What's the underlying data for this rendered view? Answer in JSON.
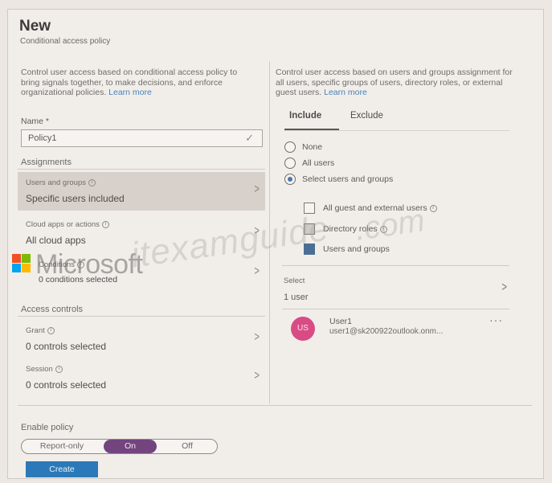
{
  "header": {
    "title": "New",
    "subtitle": "Conditional access policy"
  },
  "left": {
    "description": "Control user access based on conditional access policy to bring signals together, to make decisions, and enforce organizational policies.",
    "learn_more": "Learn more",
    "name_label": "Name *",
    "name_value": "Policy1",
    "assignments_heading": "Assignments",
    "users_label": "Users and groups",
    "users_value": "Specific users included",
    "cloud_label": "Cloud apps or actions",
    "cloud_value": "All cloud apps",
    "conditions_label": "Conditions",
    "conditions_value": "0 conditions selected",
    "access_heading": "Access controls",
    "grant_label": "Grant",
    "grant_value": "0 controls selected",
    "session_label": "Session",
    "session_value": "0 controls selected",
    "enable_label": "Enable policy",
    "toggle_options": [
      "Report-only",
      "On",
      "Off"
    ],
    "toggle_selected": "On",
    "create_label": "Create"
  },
  "right": {
    "description": "Control user access based on users and groups assignment for all users, specific groups of users, directory roles, or external guest users.",
    "learn_more": "Learn more",
    "tabs": [
      "Include",
      "Exclude"
    ],
    "active_tab": "Include",
    "radios": [
      "None",
      "All users",
      "Select users and groups"
    ],
    "selected_radio": "Select users and groups",
    "checkboxes": [
      "All guest and external users",
      "Directory roles",
      "Users and groups"
    ],
    "checked": "Users and groups",
    "select_label": "Select",
    "select_value": "1 user",
    "user_initials": "US",
    "user_name": "User1",
    "user_email": "user1@sk200922outlook.onm...",
    "more": "···"
  },
  "overlays": {
    "brand_text": "Microsoft",
    "watermark": "itexamguide",
    "watermark_tail": ".com"
  },
  "colors": {
    "accent": "#2b79b8",
    "toggle_on": "#74447f",
    "avatar": "#d94b85",
    "checkbox_checked": "#4b6f94"
  }
}
